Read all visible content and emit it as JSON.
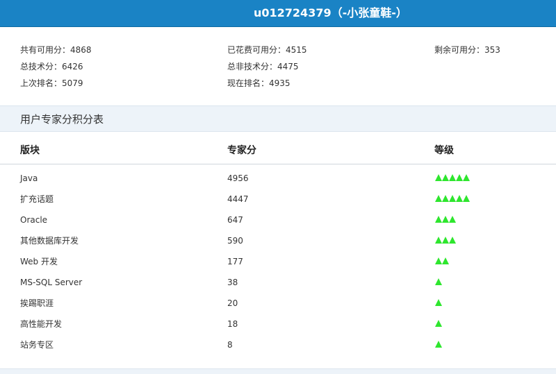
{
  "header": {
    "title": "u012724379（-小张童鞋-）"
  },
  "stats": {
    "total_available": "共有可用分：4868",
    "spent_available": "已花费可用分：4515",
    "remaining_available": "剩余可用分：353",
    "total_tech": "总技术分：6426",
    "total_non_tech": "总非技术分：4475",
    "last_rank": "上次排名：5079",
    "current_rank": "现在排名：4935"
  },
  "section": {
    "title": "用户专家分积分表"
  },
  "table": {
    "columns": [
      "版块",
      "专家分",
      "等级"
    ],
    "level_color": "#2ee62e",
    "rows": [
      {
        "board": "Java",
        "score": "4956",
        "level": 5
      },
      {
        "board": "扩充话题",
        "score": "4447",
        "level": 5
      },
      {
        "board": "Oracle",
        "score": "647",
        "level": 3
      },
      {
        "board": "其他数据库开发",
        "score": "590",
        "level": 3
      },
      {
        "board": "Web 开发",
        "score": "177",
        "level": 2
      },
      {
        "board": "MS-SQL Server",
        "score": "38",
        "level": 1
      },
      {
        "board": "挨踢职涯",
        "score": "20",
        "level": 1
      },
      {
        "board": "高性能开发",
        "score": "18",
        "level": 1
      },
      {
        "board": "站务专区",
        "score": "8",
        "level": 1
      }
    ]
  },
  "colors": {
    "header_bg": "#1a83c5",
    "section_bg": "#edf3f9"
  }
}
